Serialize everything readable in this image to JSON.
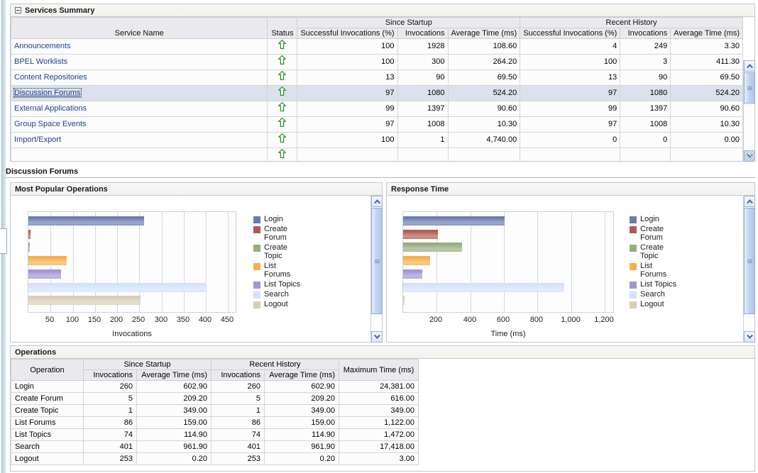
{
  "services_panel": {
    "title": "Services Summary",
    "columns": {
      "service_name": "Service Name",
      "status": "Status",
      "group_since_startup": "Since Startup",
      "group_recent_history": "Recent History",
      "successful_invocations_pct": "Successful Invocations (%)",
      "invocations": "Invocations",
      "average_time_ms": "Average Time (ms)"
    },
    "rows": [
      {
        "name": "Announcements",
        "status": "up-arrow-icon",
        "ss_pct": "100",
        "ss_inv": "1928",
        "ss_avg": "108.60",
        "rh_pct": "4",
        "rh_inv": "249",
        "rh_avg": "3.30",
        "selected": false
      },
      {
        "name": "BPEL Worklists",
        "status": "up-arrow-icon",
        "ss_pct": "100",
        "ss_inv": "300",
        "ss_avg": "264.20",
        "rh_pct": "100",
        "rh_inv": "3",
        "rh_avg": "411.30",
        "selected": false
      },
      {
        "name": "Content Repositories",
        "status": "up-arrow-icon",
        "ss_pct": "13",
        "ss_inv": "90",
        "ss_avg": "69.50",
        "rh_pct": "13",
        "rh_inv": "90",
        "rh_avg": "69.50",
        "selected": false
      },
      {
        "name": "Discussion Forums",
        "status": "up-arrow-icon",
        "ss_pct": "97",
        "ss_inv": "1080",
        "ss_avg": "524.20",
        "rh_pct": "97",
        "rh_inv": "1080",
        "rh_avg": "524.20",
        "selected": true
      },
      {
        "name": "External Applications",
        "status": "up-arrow-icon",
        "ss_pct": "99",
        "ss_inv": "1397",
        "ss_avg": "90.60",
        "rh_pct": "99",
        "rh_inv": "1397",
        "rh_avg": "90.60",
        "selected": false
      },
      {
        "name": "Group Space Events",
        "status": "up-arrow-icon",
        "ss_pct": "97",
        "ss_inv": "1008",
        "ss_avg": "10.30",
        "rh_pct": "97",
        "rh_inv": "1008",
        "rh_avg": "10.30",
        "selected": false
      },
      {
        "name": "Import/Export",
        "status": "up-arrow-icon",
        "ss_pct": "100",
        "ss_inv": "1",
        "ss_avg": "4,740.00",
        "rh_pct": "0",
        "rh_inv": "0",
        "rh_avg": "0.00",
        "selected": false
      }
    ]
  },
  "section_title": "Discussion Forums",
  "chart_data": [
    {
      "type": "bar",
      "orientation": "horizontal",
      "panel_title": "Most Popular Operations",
      "title": "Most Popular Operations",
      "categories": [
        "Login",
        "Create Forum",
        "Create Topic",
        "List Forums",
        "List Topics",
        "Search",
        "Logout"
      ],
      "values": [
        260,
        5,
        1,
        86,
        74,
        401,
        253
      ],
      "xlabel": "Invocations",
      "ylabel": "",
      "xlim": [
        0,
        470
      ],
      "xticks": [
        50,
        100,
        150,
        200,
        250,
        300,
        350,
        400,
        450
      ],
      "xticklabels": [
        "50",
        "100",
        "150",
        "200",
        "250",
        "300",
        "350",
        "400",
        "450"
      ],
      "grid": true,
      "legend_position": "right",
      "colors": [
        "#6b7cb0",
        "#b05b52",
        "#96ad7e",
        "#f6ae4c",
        "#a394d8",
        "#d5e1fb",
        "#d9cdb5"
      ]
    },
    {
      "type": "bar",
      "orientation": "horizontal",
      "panel_title": "Response Time",
      "title": "Response Time",
      "categories": [
        "Login",
        "Create Forum",
        "Create Topic",
        "List Forums",
        "List Topics",
        "Search",
        "Logout"
      ],
      "values": [
        602.9,
        209.2,
        349.0,
        159.0,
        114.9,
        961.9,
        0.2
      ],
      "xlabel": "Time (ms)",
      "ylabel": "",
      "xlim": [
        0,
        1260
      ],
      "xticks": [
        200,
        400,
        600,
        800,
        1000,
        1200
      ],
      "xticklabels": [
        "200",
        "400",
        "600",
        "800",
        "1,000",
        "1,200"
      ],
      "grid": true,
      "legend_position": "right",
      "colors": [
        "#6b7cb0",
        "#b05b52",
        "#96ad7e",
        "#f6ae4c",
        "#a394d8",
        "#d5e1fb",
        "#d9cdb5"
      ]
    }
  ],
  "operations_panel": {
    "title": "Operations",
    "columns": {
      "operation": "Operation",
      "group_since_startup": "Since Startup",
      "group_recent_history": "Recent History",
      "invocations": "Invocations",
      "average_time_ms": "Average Time (ms)",
      "maximum_time_ms": "Maximum Time (ms)"
    },
    "rows": [
      {
        "operation": "Login",
        "ss_inv": "260",
        "ss_avg": "602.90",
        "rh_inv": "260",
        "rh_avg": "602.90",
        "max": "24,381.00"
      },
      {
        "operation": "Create Forum",
        "ss_inv": "5",
        "ss_avg": "209.20",
        "rh_inv": "5",
        "rh_avg": "209.20",
        "max": "616.00"
      },
      {
        "operation": "Create Topic",
        "ss_inv": "1",
        "ss_avg": "349.00",
        "rh_inv": "1",
        "rh_avg": "349.00",
        "max": "349.00"
      },
      {
        "operation": "List Forums",
        "ss_inv": "86",
        "ss_avg": "159.00",
        "rh_inv": "86",
        "rh_avg": "159.00",
        "max": "1,122.00"
      },
      {
        "operation": "List Topics",
        "ss_inv": "74",
        "ss_avg": "114.90",
        "rh_inv": "74",
        "rh_avg": "114.90",
        "max": "1,472.00"
      },
      {
        "operation": "Search",
        "ss_inv": "401",
        "ss_avg": "961.90",
        "rh_inv": "401",
        "rh_avg": "961.90",
        "max": "17,418.00"
      },
      {
        "operation": "Logout",
        "ss_inv": "253",
        "ss_avg": "0.20",
        "rh_inv": "253",
        "rh_avg": "0.20",
        "max": "3.00"
      }
    ]
  },
  "colors": {
    "link": "#1f3f8f",
    "status_up": "#2a8a2a",
    "selected_row": "#dbe2ed",
    "header_bg": "#eaeaee"
  }
}
